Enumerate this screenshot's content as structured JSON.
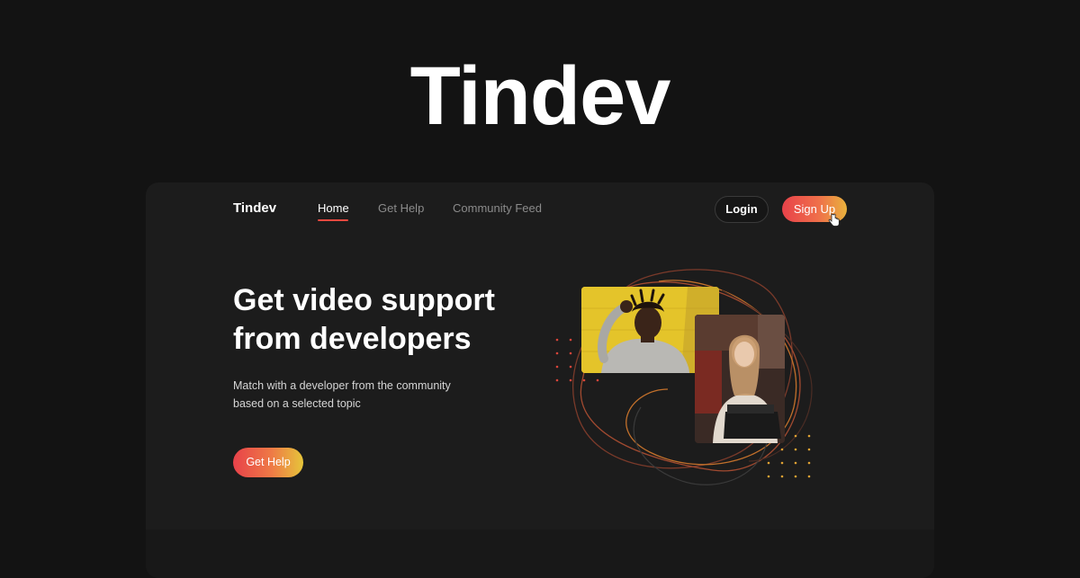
{
  "hero_heading": "Tindev",
  "nav": {
    "brand": "Tindev",
    "links": [
      "Home",
      "Get Help",
      "Community Feed"
    ],
    "active_link": "Home",
    "login_label": "Login",
    "signup_label": "Sign Up"
  },
  "hero": {
    "title": "Get video support from developers",
    "subtitle": "Match  with a developer from the community based on a selected topic",
    "cta_label": "Get Help"
  },
  "colors": {
    "background": "#131313",
    "card": "#1c1c1c",
    "accent_red": "#e8424a",
    "accent_yellow": "#e9b23d"
  }
}
